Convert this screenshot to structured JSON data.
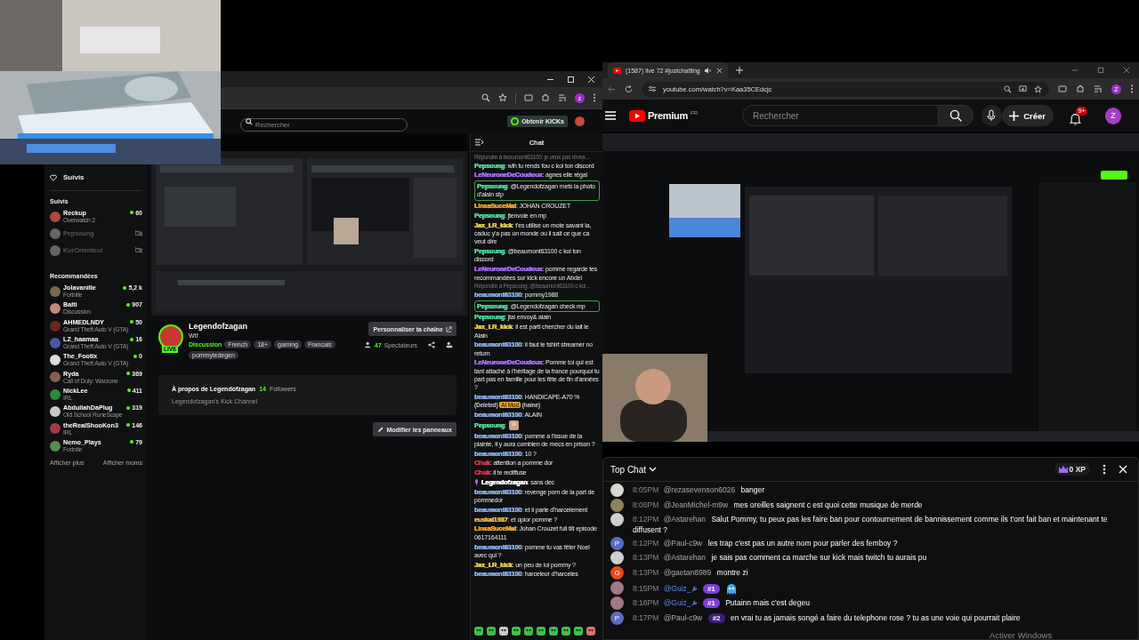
{
  "kick_window": {
    "search": {
      "placeholder": "Rechercher"
    },
    "get_kicks_button": "Obtenir KICKs",
    "profile_letter": "z",
    "sidebar": {
      "nav_label": "Suivis",
      "followed_heading": "Suivis",
      "followed": [
        {
          "name": "Reckup",
          "category": "Overwatch 2",
          "viewers": "60",
          "live": true
        },
        {
          "name": "Pepsoung",
          "live": false
        },
        {
          "name": "KurOrienteur",
          "live": false
        }
      ],
      "recommended_heading": "Recommandées",
      "recommended": [
        {
          "name": "Jolavanille",
          "category": "Fortnite",
          "viewers": "5,2 k"
        },
        {
          "name": "Balti",
          "category": "Discussion",
          "viewers": "907"
        },
        {
          "name": "AHMEDLNDY",
          "category": "Grand Theft Auto V (GTA)",
          "viewers": "50"
        },
        {
          "name": "LZ_haamaa",
          "category": "Grand Theft Auto V (GTA)",
          "viewers": "16"
        },
        {
          "name": "The_Footix",
          "category": "Grand Theft Auto V (GTA)",
          "viewers": "0"
        },
        {
          "name": "Ryda",
          "category": "Call of Duty: Warzone",
          "viewers": "369"
        },
        {
          "name": "NickLee",
          "category": "IRL",
          "viewers": "411"
        },
        {
          "name": "AbdullahDaPlug",
          "category": "Old School RuneScape",
          "viewers": "319"
        },
        {
          "name": "theRealShooKon3",
          "category": "IRL",
          "viewers": "146"
        },
        {
          "name": "Nemo_Plays",
          "category": "Fortnite",
          "viewers": "79"
        }
      ],
      "show_more": "Afficher plus",
      "show_less": "Afficher moins"
    },
    "channel": {
      "name": "Legendofzagan",
      "live_badge": "LIVE",
      "title": "Wtf",
      "category": "Discussion",
      "tags": [
        "French",
        "18+",
        "gaming",
        "Francais",
        "pommyledegen"
      ],
      "customize_button": "Personnaliser ta chaîne",
      "viewer_count": "47",
      "viewer_label": "Spectateurs",
      "about_title": "À propos de Legendofzagan",
      "followers_count": "14",
      "followers_label": "Followers",
      "about_text": "Legendofzagan's Kick Channel",
      "edit_panels_button": "Modifier les panneaux"
    },
    "chat": {
      "title": "Chat",
      "separator": ":",
      "messages": [
        {
          "kind": "reply",
          "text": "Répondre à beaumont63100: je veux pas revea..."
        },
        {
          "kind": "message",
          "user": "Pepsoung",
          "color": "#4fd49c",
          "text": "wlh tu rends fou c koi ton discord",
          "highlighted": false
        },
        {
          "kind": "message",
          "user": "LeNeuroneDeCoudoux",
          "color": "#a66cf2",
          "text": "agnes elle régal",
          "highlighted": false
        },
        {
          "kind": "message",
          "user": "Pepsoung",
          "color": "#4fd49c",
          "text": "@Legendofzagan mets la photo d'alain stp",
          "highlighted": true
        },
        {
          "kind": "message",
          "user": "LinsaSuceMal",
          "color": "#f0a030",
          "text": "JOHAN CROUZET",
          "highlighted": false
        },
        {
          "kind": "message",
          "user": "Pepsoung",
          "color": "#4fd49c",
          "text": "jtenvoie en mp",
          "highlighted": false
        },
        {
          "kind": "message",
          "user": "Jax_LR_kick",
          "color": "#e2c84a",
          "text": "t'es utilise un mote savant la, caduc y'a pas un monde ou il sait ce que ca veut dire",
          "highlighted": false
        },
        {
          "kind": "message",
          "user": "Pepsoung",
          "color": "#4fd49c",
          "text": "@beaumont63100 c koi ton discord",
          "highlighted": false
        },
        {
          "kind": "message",
          "user": "LeNeuroneDeCoudoux",
          "color": "#a66cf2",
          "text": "pomme regarde tes recommandées sur kick encore un Abdel",
          "highlighted": false
        },
        {
          "kind": "reply",
          "text": "Répondre à Pepsoung: @beaumont63100 c koi..."
        },
        {
          "kind": "message",
          "user": "beaumont63100",
          "color": "#86a9e0",
          "text": "pommy1988",
          "highlighted": false
        },
        {
          "kind": "message",
          "user": "Pepsoung",
          "color": "#4fd49c",
          "text": "@Legendofzagan check mp",
          "highlighted": true
        },
        {
          "kind": "message",
          "user": "Pepsoung",
          "color": "#4fd49c",
          "text": "jtai envoy& alain",
          "highlighted": false
        },
        {
          "kind": "message",
          "user": "Jax_LR_kick",
          "color": "#e2c84a",
          "text": "il est parti chercher du lait le Alain",
          "highlighted": false
        },
        {
          "kind": "message",
          "user": "beaumont63100",
          "color": "#86a9e0",
          "text": "il faut le tshirt streamer no return",
          "highlighted": false
        },
        {
          "kind": "message",
          "user": "LeNeuroneDeCoudoux",
          "color": "#a66cf2",
          "text": "Pomme toi qui est tant attaché à l'héritage de la france pourquoi tu part pas en famille pour les fête de fin d'années ?",
          "highlighted": false
        },
        {
          "kind": "moderated",
          "user": "beaumont63100",
          "color": "#86a9e0",
          "text": "HANDICAPE-A70 %",
          "deleted_label": "(Deleted)",
          "mod_badge": "AI Mod",
          "reason": "(haine)",
          "highlighted": false
        },
        {
          "kind": "message",
          "user": "beaumont63100",
          "color": "#86a9e0",
          "text": "ALAIN",
          "highlighted": false
        },
        {
          "kind": "emote",
          "user": "Pepsoung",
          "color": "#4fd49c",
          "highlighted": false
        },
        {
          "kind": "message",
          "user": "beaumont63100",
          "color": "#86a9e0",
          "text": "pomme a l'issue de la plainte, il y aura combien de mecs en prison ?",
          "highlighted": false
        },
        {
          "kind": "message",
          "user": "beaumont63100",
          "color": "#86a9e0",
          "text": "10 ?",
          "highlighted": false
        },
        {
          "kind": "message",
          "user": "Chuk",
          "color": "#e0304a",
          "text": "attention a pomme dor",
          "highlighted": false
        },
        {
          "kind": "message",
          "user": "Chuk",
          "color": "#e0304a",
          "text": "il te rediffuse",
          "highlighted": false
        },
        {
          "kind": "broadcaster",
          "user": "Legendofzagan",
          "color": "#ffffff",
          "text": "sans dec",
          "highlighted": false
        },
        {
          "kind": "message",
          "user": "beaumont63100",
          "color": "#86a9e0",
          "text": "revenge porn de la part de pommedor",
          "highlighted": false
        },
        {
          "kind": "message",
          "user": "beaumont63100",
          "color": "#86a9e0",
          "text": "et il parle d'harcelement",
          "highlighted": false
        },
        {
          "kind": "message",
          "user": "euskal1987",
          "color": "#e0b040",
          "text": "et opior pomme ?",
          "highlighted": false
        },
        {
          "kind": "message",
          "user": "LinsaSuceMal",
          "color": "#f0a030",
          "text": "Johan Crouzet full tilt episode 0617164111",
          "highlighted": false
        },
        {
          "kind": "message",
          "user": "beaumont63100",
          "color": "#86a9e0",
          "text": "pomme tu vas fêter Noel avec qui ?",
          "highlighted": false
        },
        {
          "kind": "message",
          "user": "Jax_LR_kick",
          "color": "#e2c84a",
          "text": "un peu de loi pommy ?",
          "highlighted": false
        },
        {
          "kind": "message",
          "user": "beaumont63100",
          "color": "#86a9e0",
          "text": "harceleur d'harceles",
          "highlighted": false
        }
      ]
    }
  },
  "youtube_window": {
    "tab_title": "(1587) live 72 #justchatting",
    "address": "youtube.com/watch?v=Kaa35CEdcjc",
    "profile_letter": "Z",
    "logo_text": "Premium",
    "region": "FR",
    "search": {
      "placeholder": "Rechercher"
    },
    "create_button": "Créer",
    "notifications": "9+",
    "avatar_letter": "Z",
    "chat": {
      "title": "Top Chat",
      "xp": "0 XP",
      "messages": [
        {
          "kind": "text",
          "time": "8:05PM",
          "author": "@rezasevenson6026",
          "moderator": false,
          "text": "banger"
        },
        {
          "kind": "text",
          "time": "8:06PM",
          "author": "@JeanMichel-m9w",
          "moderator": false,
          "text": "mes oreilles saignent c est quoi cette musique de merde"
        },
        {
          "kind": "text",
          "time": "8:12PM",
          "author": "@Astarehan",
          "moderator": false,
          "text": "Salut Pommy, tu peux pas les faire ban pour contournement de bannissement comme ils t'ont fait ban et maintenant te diffusent ?"
        },
        {
          "kind": "text",
          "time": "8:12PM",
          "author": "@Paul-c9w",
          "moderator": false,
          "avatar": {
            "kind": "letter",
            "letter": "P",
            "color": "#5c6bc0"
          },
          "text": "les trap c'est pas un autre nom pour parler des femboy ?"
        },
        {
          "kind": "text",
          "time": "8:13PM",
          "author": "@Astarehan",
          "moderator": false,
          "text": "je sais pas comment ca marche sur kick mais twitch tu aurais pu"
        },
        {
          "kind": "text",
          "time": "8:13PM",
          "author": "@gaetan8989",
          "moderator": false,
          "avatar": {
            "kind": "letter",
            "letter": "G",
            "color": "#e64a19"
          },
          "text": "montre zi"
        },
        {
          "kind": "sticker",
          "time": "8:15PM",
          "author": "@Guiz_",
          "moderator": true,
          "badge": "#1"
        },
        {
          "kind": "text",
          "time": "8:16PM",
          "author": "@Guiz_",
          "moderator": true,
          "badge": "#1",
          "text": "Putainn mais c'est degeu"
        },
        {
          "kind": "text",
          "time": "8:17PM",
          "author": "@Paul-c9w",
          "moderator": false,
          "avatar": {
            "kind": "letter",
            "letter": "P",
            "color": "#5c6bc0"
          },
          "badge": "#2",
          "text": "en vrai tu as jamais songé a faire du telephone rose ? tu as une voie qui pourrait plaire"
        }
      ]
    }
  },
  "os_notice": "Activer Windows"
}
